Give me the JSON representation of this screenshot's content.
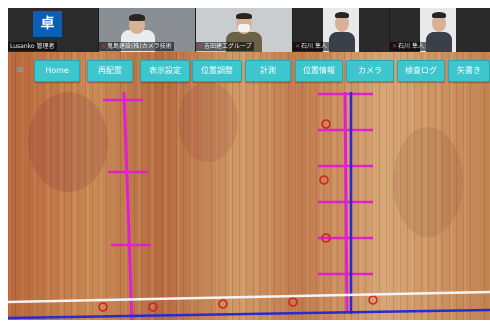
{
  "participants": [
    {
      "name": "Lusanko 管理者"
    },
    {
      "name": "鬼島建設(株)カメラ技術"
    },
    {
      "name": "吉田建工グループ"
    },
    {
      "name": "石川 隼人"
    },
    {
      "name": "石川 隼人"
    }
  ],
  "logo_text": "卓",
  "toolbar": {
    "buttons": [
      "Home",
      "再配置",
      "表示設定",
      "位置調整",
      "計測",
      "位置情報",
      "カメラ",
      "検査ログ",
      "矢書き"
    ]
  },
  "colors": {
    "accent": "#3ec6cf",
    "marker_magenta": "#e020d0",
    "marker_blue": "#2a2ad0",
    "strip_bg": "#1c1c1c"
  },
  "icons": {
    "menu": "menu-icon",
    "mic": "mic-muted-icon"
  }
}
